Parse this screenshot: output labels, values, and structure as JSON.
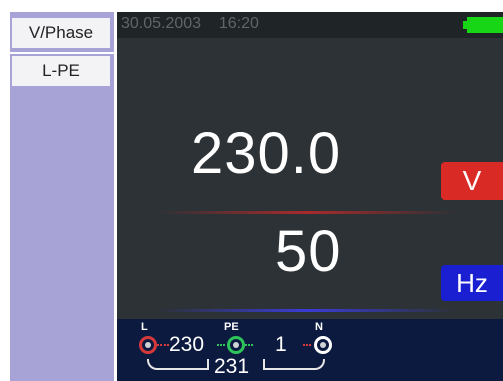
{
  "sidebar": {
    "mode_label": "V/Phase",
    "sub_label": "L-PE"
  },
  "status": {
    "date_time": "30.05.2003    16:20",
    "battery_color": "#16d616"
  },
  "reading": {
    "voltage_value": "230.0",
    "voltage_unit": "V",
    "frequency_value": "50",
    "frequency_unit": "Hz"
  },
  "terminals": {
    "l_label": "L",
    "pe_label": "PE",
    "n_label": "N",
    "l_pe_value": "230",
    "pe_n_value": "1",
    "l_n_value": "231"
  },
  "colors": {
    "voltage_badge": "#d92a25",
    "frequency_badge": "#1a1fd1",
    "terminal_l": "#d43a3a",
    "terminal_pe": "#2fc45a",
    "terminal_n": "#ffffff"
  }
}
